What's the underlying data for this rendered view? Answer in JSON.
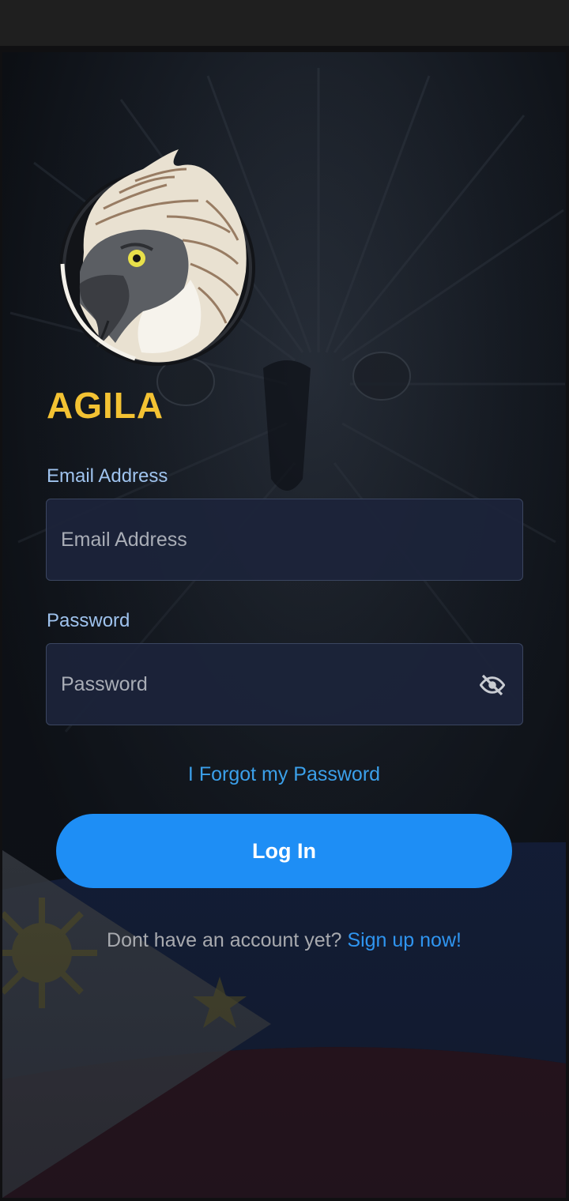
{
  "app": {
    "brand_name": "AGILA"
  },
  "form": {
    "email": {
      "label": "Email Address",
      "placeholder": "Email Address",
      "value": ""
    },
    "password": {
      "label": "Password",
      "placeholder": "Password",
      "value": "",
      "visibility_icon": "eye-off-icon"
    },
    "forgot_link": "I Forgot my Password",
    "login_button": "Log In",
    "signup_prompt": "Dont have an account yet?",
    "signup_link": "Sign up now!"
  },
  "colors": {
    "brand_yellow": "#f3c233",
    "accent_blue": "#1e8ef5",
    "link_blue": "#3ba0ea",
    "field_bg": "#1c243a",
    "label_color": "#9fc3ee"
  }
}
